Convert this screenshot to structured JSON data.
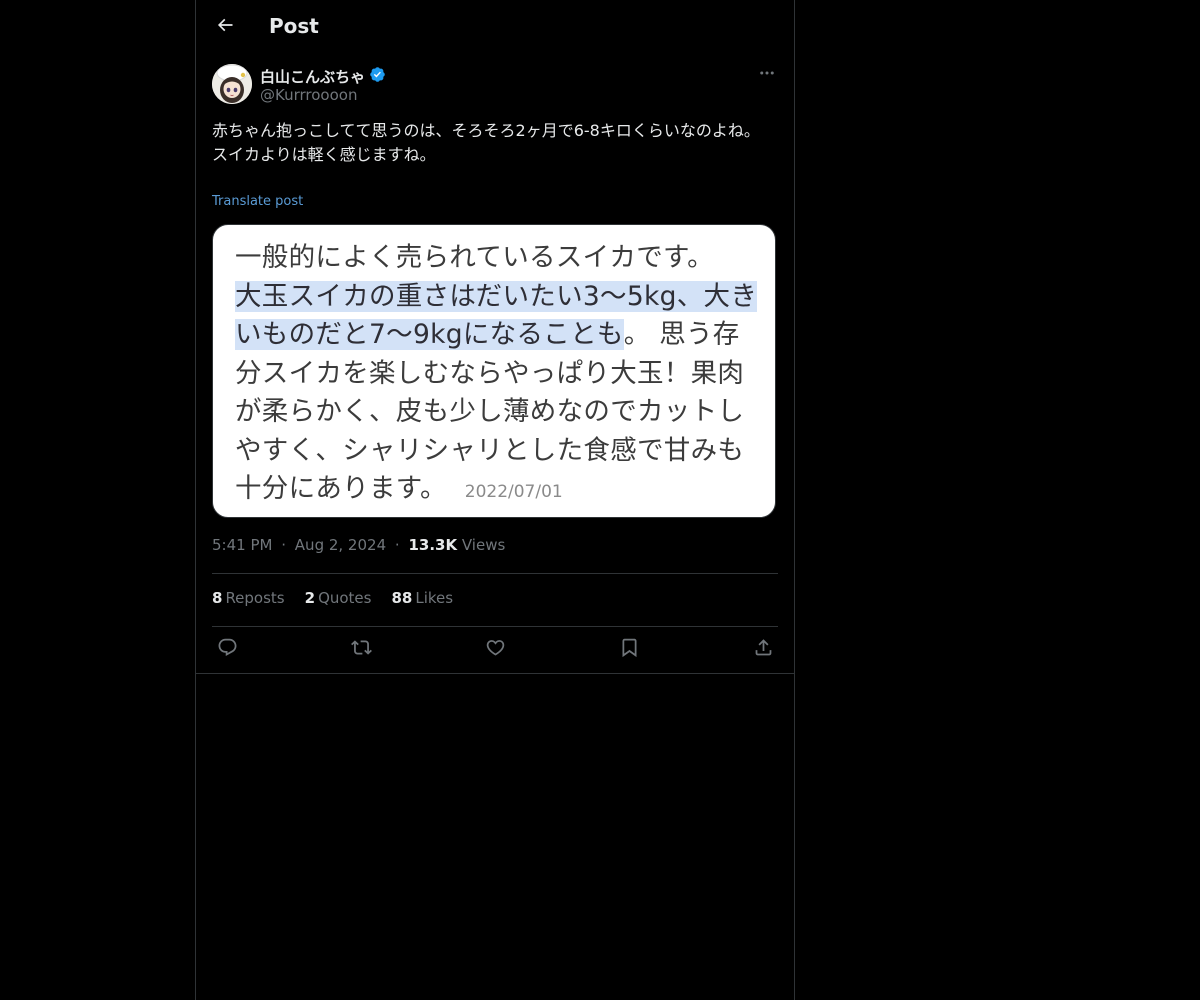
{
  "header": {
    "title": "Post"
  },
  "post": {
    "author": {
      "display_name": "白山こんぶちゃ",
      "handle": "@Kurrroooon",
      "verified": true
    },
    "text": "赤ちゃん抱っこしてて思うのは、そろそろ2ヶ月で6-8キロくらいなのよね。\nスイカよりは軽く感じますね。",
    "translate_label": "Translate post",
    "media": {
      "line1": "一般的によく売られているスイカです。",
      "highlight": "大玉スイカの重さはだいたい3〜5kg、大きいものだと7〜9kgになることも",
      "rest": "。 思う存分スイカを楽しむならやっぱり大玉！果肉が柔らかく、皮も少し薄めなのでカットしやすく、シャリシャリとした食感で甘みも十分にあります。",
      "date": "2022/07/01"
    },
    "time": "5:41 PM",
    "date": "Aug 2, 2024",
    "separator": "·",
    "views_count": "13.3K",
    "views_label": "Views",
    "stats": {
      "reposts_count": "8",
      "reposts_label": "Reposts",
      "quotes_count": "2",
      "quotes_label": "Quotes",
      "likes_count": "88",
      "likes_label": "Likes"
    }
  },
  "icons": {
    "back": "arrow-left-icon",
    "more": "more-horizontal-icon",
    "verified": "verified-badge-icon",
    "reply": "reply-icon",
    "repost": "repost-icon",
    "like": "heart-icon",
    "bookmark": "bookmark-icon",
    "share": "share-icon"
  },
  "colors": {
    "background": "#000000",
    "text": "#e7e9ea",
    "muted": "#71767b",
    "border": "#2f3336",
    "verified": "#1d9bf0",
    "link": "#5a9bd5",
    "highlight": "#d3e2f7"
  }
}
